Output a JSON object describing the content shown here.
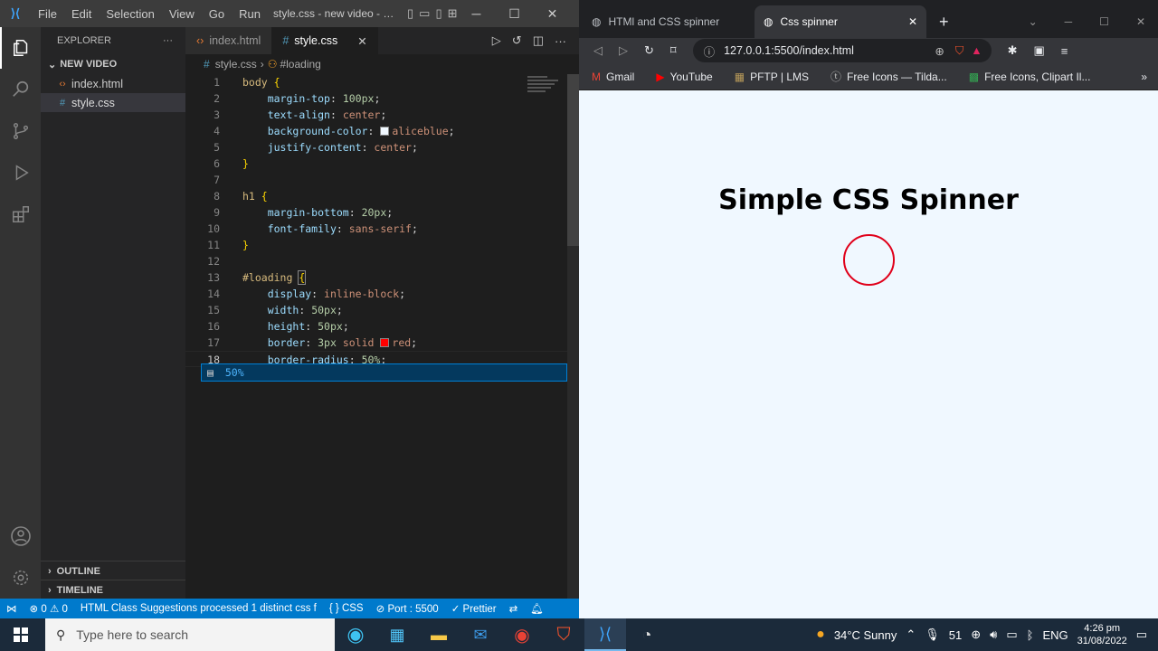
{
  "vscode": {
    "menu": [
      "File",
      "Edit",
      "Selection",
      "View",
      "Go",
      "Run"
    ],
    "title": "style.css - new video - Vis...",
    "explorer_title": "EXPLORER",
    "folder": "NEW VIDEO",
    "files": [
      "index.html",
      "style.css"
    ],
    "outline": "OUTLINE",
    "timeline": "TIMELINE",
    "tabs": [
      "index.html",
      "style.css"
    ],
    "breadcrumb": {
      "file": "style.css",
      "symbol": "#loading"
    },
    "suggestion": "50%",
    "status": {
      "errors": "0",
      "warnings": "0",
      "message": "HTML Class Suggestions processed 1 distinct css f",
      "lang": "CSS",
      "port": "Port : 5500",
      "prettier": "Prettier"
    }
  },
  "colors": {
    "accent": "#007acc",
    "spinner": "#e0001a",
    "page_bg": "#f0f8ff"
  },
  "browser": {
    "tabs": [
      "HTMl and CSS spinner",
      "Css spinner"
    ],
    "url": "127.0.0.1:5500/index.html",
    "bookmarks": [
      "Gmail",
      "YouTube",
      "PFTP | LMS",
      "Free Icons — Tilda...",
      "Free Icons, Clipart Il..."
    ],
    "heading": "Simple CSS Spinner"
  },
  "taskbar": {
    "search": "Type here to search",
    "weather": "34°C  Sunny",
    "volume": "51",
    "lang": "ENG",
    "time": "4:26 pm",
    "date": "31/08/2022"
  }
}
